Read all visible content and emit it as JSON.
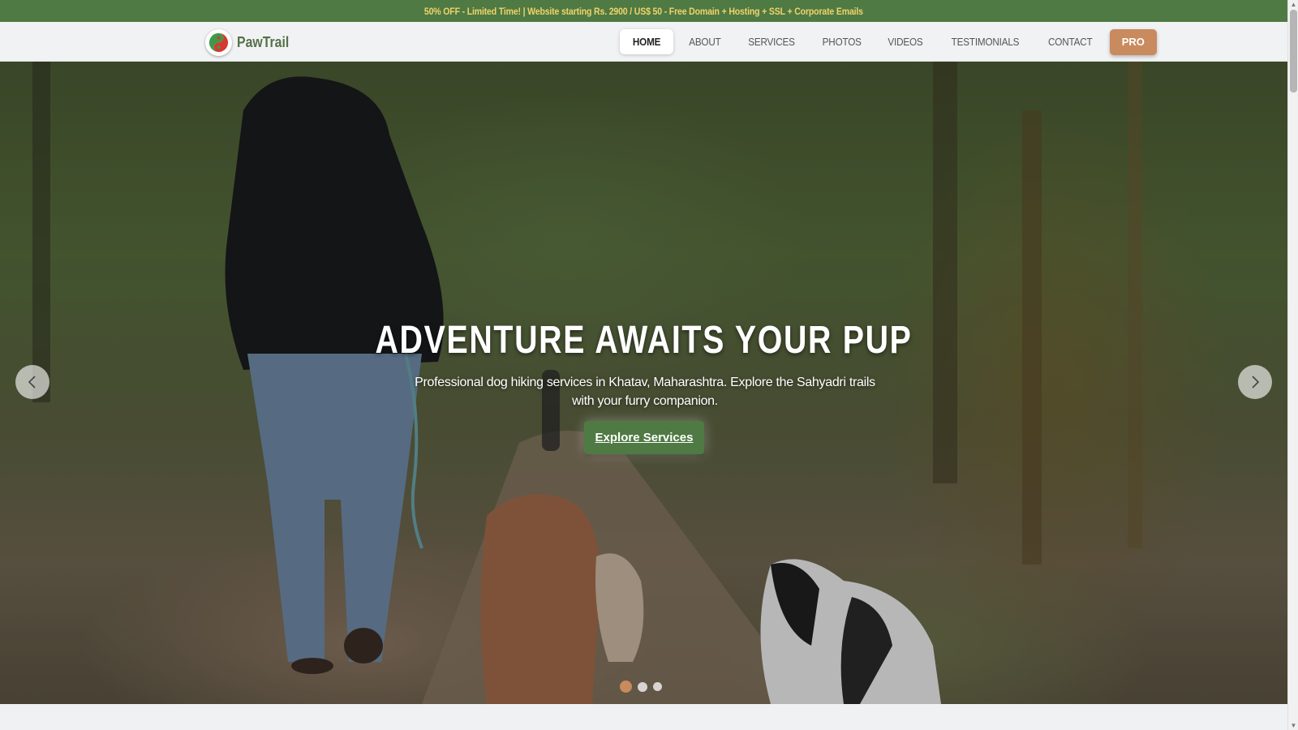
{
  "promo": {
    "text": "50% OFF - Limited Time! | Website starting Rs. 2900 / US$ 50 - Free Domain + Hosting + SSL + Corporate Emails"
  },
  "brand": {
    "name": "PawTrail",
    "logo_icon": "pawtrail-logo-icon"
  },
  "nav": {
    "items": [
      {
        "label": "HOME",
        "active": true
      },
      {
        "label": "ABOUT"
      },
      {
        "label": "SERVICES"
      },
      {
        "label": "PHOTOS"
      },
      {
        "label": "VIDEOS"
      },
      {
        "label": "TESTIMONIALS"
      },
      {
        "label": "CONTACT"
      }
    ],
    "pro_label": "PRO"
  },
  "hero": {
    "title": "ADVENTURE AWAITS YOUR PUP",
    "subtitle": "Professional dog hiking services in Khatav, Maharashtra. Explore the Sahyadri trails with your furry companion.",
    "cta_label": "Explore Services",
    "prev_icon": "chevron-left-icon",
    "next_icon": "chevron-right-icon",
    "slide_count": 3,
    "active_slide": 1
  },
  "colors": {
    "primary_green": "#4f7a43",
    "promo_text": "#f0d36a",
    "accent_tan": "#c98a5e",
    "brand_text": "#55704a"
  }
}
